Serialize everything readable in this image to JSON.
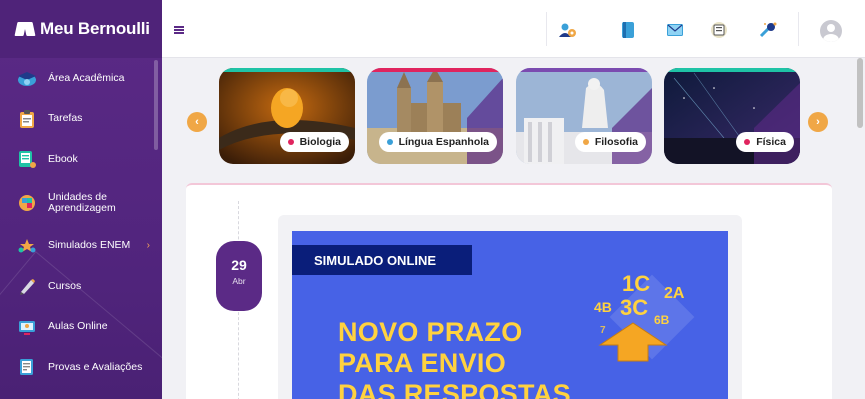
{
  "brand": {
    "name": "Meu Bernoulli"
  },
  "sidebar": {
    "items": [
      {
        "label": "Área Acadêmica",
        "icon": "graduation-cap-icon"
      },
      {
        "label": "Tarefas",
        "icon": "clipboard-icon"
      },
      {
        "label": "Ebook",
        "icon": "ebook-icon"
      },
      {
        "label": "Unidades de Aprendizagem",
        "icon": "learning-units-icon"
      },
      {
        "label": "Simulados ENEM",
        "icon": "stars-icon",
        "chevron": "›"
      },
      {
        "label": "Cursos",
        "icon": "pencil-icon"
      },
      {
        "label": "Aulas Online",
        "icon": "online-class-icon"
      },
      {
        "label": "Provas e Avaliações",
        "icon": "exam-icon"
      }
    ]
  },
  "topbar": {
    "menu_icon": "hamburger-icon",
    "icons": [
      "profile-settings-icon",
      "book-icon",
      "mail-icon",
      "news-icon",
      "tool-icon"
    ],
    "avatar": "avatar-icon"
  },
  "carousel": {
    "prev": "‹",
    "next": "›",
    "cards": [
      {
        "label": "Biologia",
        "dot_color": "#e0245e",
        "line_color": "#1fc3a6"
      },
      {
        "label": "Língua Espanhola",
        "dot_color": "#3aa0d8",
        "line_color": "#e0245e"
      },
      {
        "label": "Filosofia",
        "dot_color": "#f0a746",
        "line_color": "#7b4bb0"
      },
      {
        "label": "Física",
        "dot_color": "#e0245e",
        "line_color": "#1fc3a6"
      }
    ]
  },
  "post": {
    "day": "29",
    "month": "Abr",
    "tag": "SIMULADO ONLINE",
    "headline": [
      "NOVO PRAZO",
      "PARA ENVIO",
      "DAS RESPOSTAS"
    ],
    "classes": [
      "1C",
      "2A",
      "4B",
      "3C",
      "6B",
      "7"
    ]
  },
  "colors": {
    "accent": "#5b2a86",
    "orange": "#f0a746",
    "banner_blue": "#4762e6",
    "banner_yellow": "#ffd23f"
  }
}
